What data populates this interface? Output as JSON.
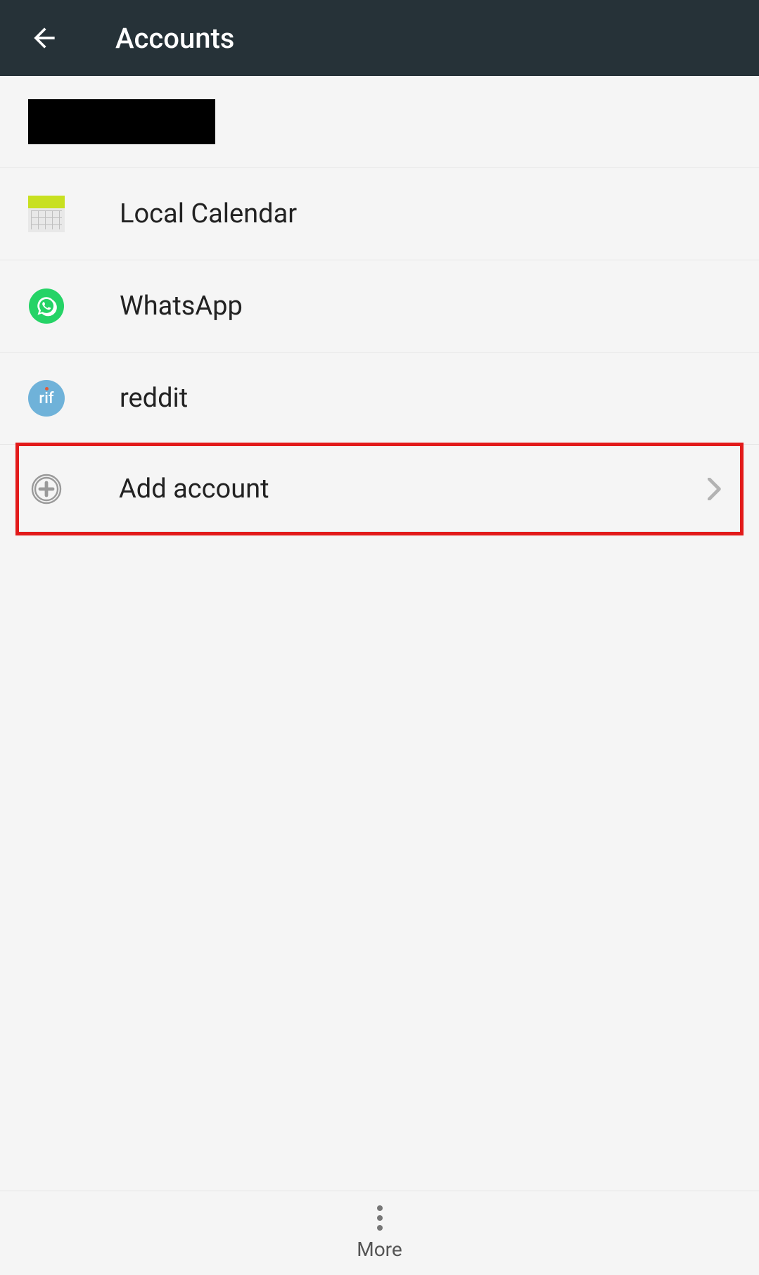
{
  "header": {
    "title": "Accounts"
  },
  "accounts": [
    {
      "label": "Local Calendar",
      "icon": "calendar"
    },
    {
      "label": "WhatsApp",
      "icon": "whatsapp"
    },
    {
      "label": "reddit",
      "icon": "rif",
      "icon_text": "rif"
    }
  ],
  "add_account": {
    "label": "Add account"
  },
  "bottom": {
    "more_label": "More"
  }
}
